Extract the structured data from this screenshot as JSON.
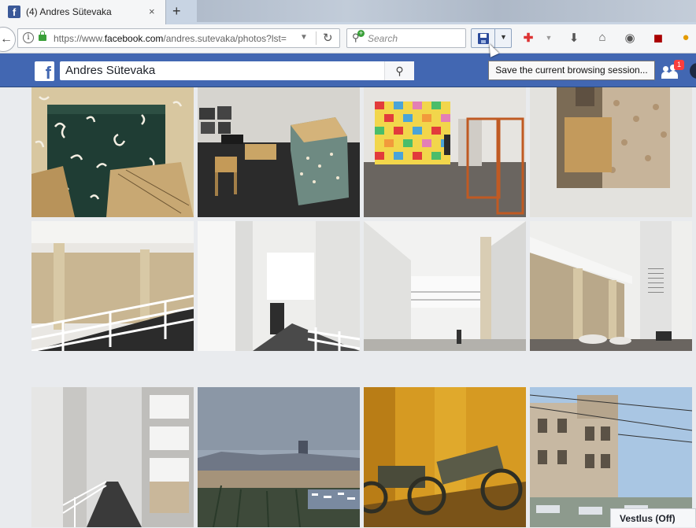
{
  "browser": {
    "tab": {
      "title": "(4) Andres Sütevaka",
      "favicon": "f",
      "close": "×"
    },
    "new_tab": "+",
    "url": {
      "prefix": "https://www.",
      "domain": "facebook.com",
      "path": "/andres.sutevaka/photos?lst="
    },
    "search_placeholder": "Search",
    "tooltip": "Save the current browsing session..."
  },
  "facebook": {
    "logo": "f",
    "search_value": "Andres Sütevaka",
    "friend_requests_count": "1"
  },
  "chat": {
    "label": "Vestlus (Off)"
  },
  "photos": [
    {
      "name": "photo-paper-sculpture-closeup",
      "bg": "#3e4a3c"
    },
    {
      "name": "photo-gallery-paper-furniture",
      "bg": "#6a6660"
    },
    {
      "name": "photo-colorful-grid-artwork",
      "bg": "#c9c6bf"
    },
    {
      "name": "photo-wall-collage",
      "bg": "#dcdbd7"
    },
    {
      "name": "photo-museum-ramp-1",
      "bg": "#bdb9b0"
    },
    {
      "name": "photo-museum-corridor-1",
      "bg": "#d8d8d6"
    },
    {
      "name": "photo-museum-atrium",
      "bg": "#e4e4e2"
    },
    {
      "name": "photo-museum-atrium-people",
      "bg": "#c9c6bf"
    },
    {
      "name": "photo-museum-ramp-2",
      "bg": "#c0c2c1"
    },
    {
      "name": "photo-barcelona-harbour",
      "bg": "#7b8694"
    },
    {
      "name": "photo-cannons-yellow-room",
      "bg": "#c98a1a"
    },
    {
      "name": "photo-old-building-street",
      "bg": "#b7b1a5"
    }
  ]
}
